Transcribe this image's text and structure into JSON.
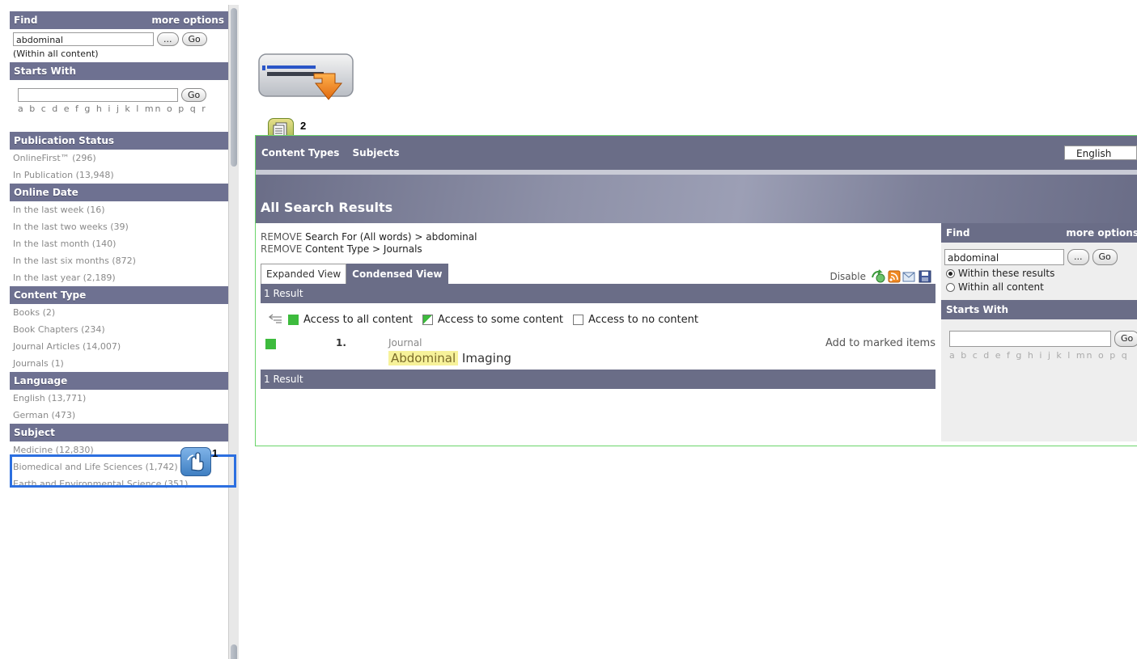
{
  "sidebar": {
    "find": {
      "title": "Find",
      "more": "more options",
      "value": "abdominal",
      "browse": "...",
      "go": "Go",
      "note": "(Within all content)"
    },
    "starts_with": {
      "title": "Starts With",
      "value": "",
      "go": "Go",
      "alphabet": "a b c d e f g h i j k l mn o p q r"
    },
    "publication_status": {
      "title": "Publication Status",
      "items": [
        "OnlineFirst™ (296)",
        "In Publication (13,948)"
      ]
    },
    "online_date": {
      "title": "Online Date",
      "items": [
        "In the last week (16)",
        "In the last two weeks (39)",
        "In the last month (140)",
        "In the last six months (872)",
        "In the last year (2,189)"
      ]
    },
    "content_type": {
      "title": "Content Type",
      "items": [
        "Books (2)",
        "Book Chapters (234)",
        "Journal Articles (14,007)",
        "Journals (1)"
      ]
    },
    "language": {
      "title": "Language",
      "items": [
        "English (13,771)",
        "German (473)"
      ]
    },
    "subject": {
      "title": "Subject",
      "items": [
        "Medicine (12,830)",
        "Biomedical and Life Sciences (1,742)",
        "Earth and Environmental Science (351)"
      ]
    }
  },
  "badges": {
    "one": "1",
    "two": "2"
  },
  "topbar": {
    "content_types": "Content Types",
    "subjects": "Subjects",
    "language": "English"
  },
  "banner_title": "All Search Results",
  "breadcrumbs": [
    {
      "remove": "REMOVE",
      "text": " Search For (All words) > abdominal"
    },
    {
      "remove": "REMOVE",
      "text": " Content Type > Journals"
    }
  ],
  "views": {
    "expanded": "Expanded View",
    "condensed": "Condensed View",
    "disable": "Disable"
  },
  "result_count": "1 Result",
  "legend": {
    "all": "Access to all content",
    "some": "Access to some content",
    "none": "Access to no content"
  },
  "result": {
    "number": "1.",
    "type": "Journal",
    "title_highlight": "Abdominal",
    "title_rest": " Imaging",
    "add": "Add to marked items"
  },
  "right_panel": {
    "find_title": "Find",
    "more": "more options",
    "value": "abdominal",
    "browse": "...",
    "go": "Go",
    "radio_within_results": "Within these results",
    "radio_within_all": "Within all content",
    "starts_with": "Starts With",
    "go2": "Go",
    "alphabet": "a b c d e f g h i j k l mn o p q"
  },
  "colors": {
    "header": "#6a6d87",
    "access_green": "#3dbb3d",
    "highlight_box": "#2c6fe0",
    "panel_border": "#6ad46a"
  }
}
